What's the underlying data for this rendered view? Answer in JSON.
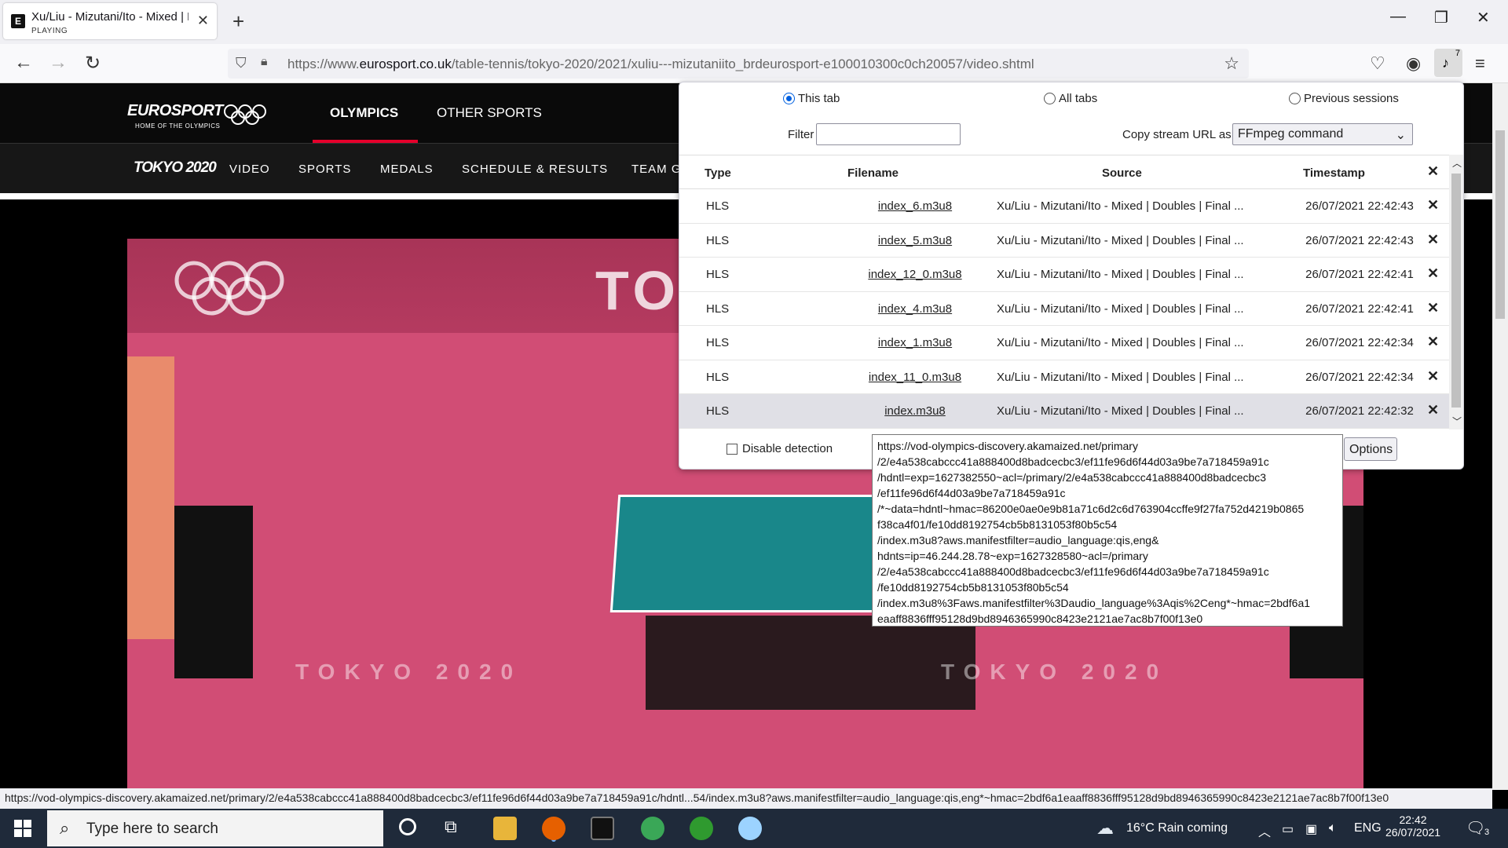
{
  "tab": {
    "title": "Xu/Liu - Mizutani/Ito - Mixed | D",
    "status": "PLAYING"
  },
  "url": {
    "prefix": "https://www.",
    "domain": "eurosport.co.uk",
    "path": "/table-tennis/tokyo-2020/2021/xuliu---mizutaniito_brdeurosport-e100010300c0ch20057/video.shtml"
  },
  "extension_badge": "7",
  "site": {
    "logo": "EUROSPORT",
    "logo_sub": "HOME OF THE OLYMPICS",
    "main_nav": [
      "OLYMPICS",
      "OTHER SPORTS"
    ],
    "tokyo_logo": "TOKYO 2020",
    "sub_nav": [
      "VIDEO",
      "SPORTS",
      "MEDALS",
      "SCHEDULE & RESULTS",
      "TEAM G"
    ]
  },
  "video_overlay": {
    "floor_text_1": "TOKYO 2020",
    "floor_text_2": "TOKYO 2020",
    "wall_text": "TO"
  },
  "popup": {
    "scope": [
      "This tab",
      "All tabs",
      "Previous sessions"
    ],
    "filter_label": "Filter",
    "copy_label": "Copy stream URL as",
    "copy_value": "FFmpeg command",
    "headers": {
      "type": "Type",
      "filename": "Filename",
      "source": "Source",
      "timestamp": "Timestamp"
    },
    "rows": [
      {
        "type": "HLS",
        "filename": "index_6.m3u8",
        "source": "Xu/Liu - Mizutani/Ito - Mixed | Doubles | Final ...",
        "timestamp": "26/07/2021 22:42:43"
      },
      {
        "type": "HLS",
        "filename": "index_5.m3u8",
        "source": "Xu/Liu - Mizutani/Ito - Mixed | Doubles | Final ...",
        "timestamp": "26/07/2021 22:42:43"
      },
      {
        "type": "HLS",
        "filename": "index_12_0.m3u8",
        "source": "Xu/Liu - Mizutani/Ito - Mixed | Doubles | Final ...",
        "timestamp": "26/07/2021 22:42:41"
      },
      {
        "type": "HLS",
        "filename": "index_4.m3u8",
        "source": "Xu/Liu - Mizutani/Ito - Mixed | Doubles | Final ...",
        "timestamp": "26/07/2021 22:42:41"
      },
      {
        "type": "HLS",
        "filename": "index_1.m3u8",
        "source": "Xu/Liu - Mizutani/Ito - Mixed | Doubles | Final ...",
        "timestamp": "26/07/2021 22:42:34"
      },
      {
        "type": "HLS",
        "filename": "index_11_0.m3u8",
        "source": "Xu/Liu - Mizutani/Ito - Mixed | Doubles | Final ...",
        "timestamp": "26/07/2021 22:42:34"
      },
      {
        "type": "HLS",
        "filename": "index.m3u8",
        "source": "Xu/Liu - Mizutani/Ito - Mixed | Doubles | Final ...",
        "timestamp": "26/07/2021 22:42:32"
      }
    ],
    "disable_detection": "Disable detection",
    "options": "Options"
  },
  "tooltip": "https://vod-olympics-discovery.akamaized.net/primary\n/2/e4a538cabccc41a888400d8badcecbc3/ef11fe96d6f44d03a9be7a718459a91c\n/hdntl=exp=1627382550~acl=/primary/2/e4a538cabccc41a888400d8badcecbc3\n/ef11fe96d6f44d03a9be7a718459a91c\n/*~data=hdntl~hmac=86200e0ae0e9b81a71c6d2c6d763904ccffe9f27fa752d4219b0865\nf38ca4f01/fe10dd8192754cb5b8131053f80b5c54\n/index.m3u8?aws.manifestfilter=audio_language:qis,eng&\nhdnts=ip=46.244.28.78~exp=1627328580~acl=/primary\n/2/e4a538cabccc41a888400d8badcecbc3/ef11fe96d6f44d03a9be7a718459a91c\n/fe10dd8192754cb5b8131053f80b5c54\n/index.m3u8%3Faws.manifestfilter%3Daudio_language%3Aqis%2Ceng*~hmac=2bdf6a1\neaaff8836fff95128d9bd8946365990c8423e2121ae7ac8b7f00f13e0",
  "status_url": "https://vod-olympics-discovery.akamaized.net/primary/2/e4a538cabccc41a888400d8badcecbc3/ef11fe96d6f44d03a9be7a718459a91c/hdntl...54/index.m3u8?aws.manifestfilter=audio_language:qis,eng*~hmac=2bdf6a1eaaff8836fff95128d9bd8946365990c8423e2121ae7ac8b7f00f13e0",
  "taskbar": {
    "search_placeholder": "Type here to search",
    "weather": "16°C  Rain coming",
    "lang": "ENG",
    "time": "22:42",
    "date": "26/07/2021",
    "notif_count": "3"
  }
}
